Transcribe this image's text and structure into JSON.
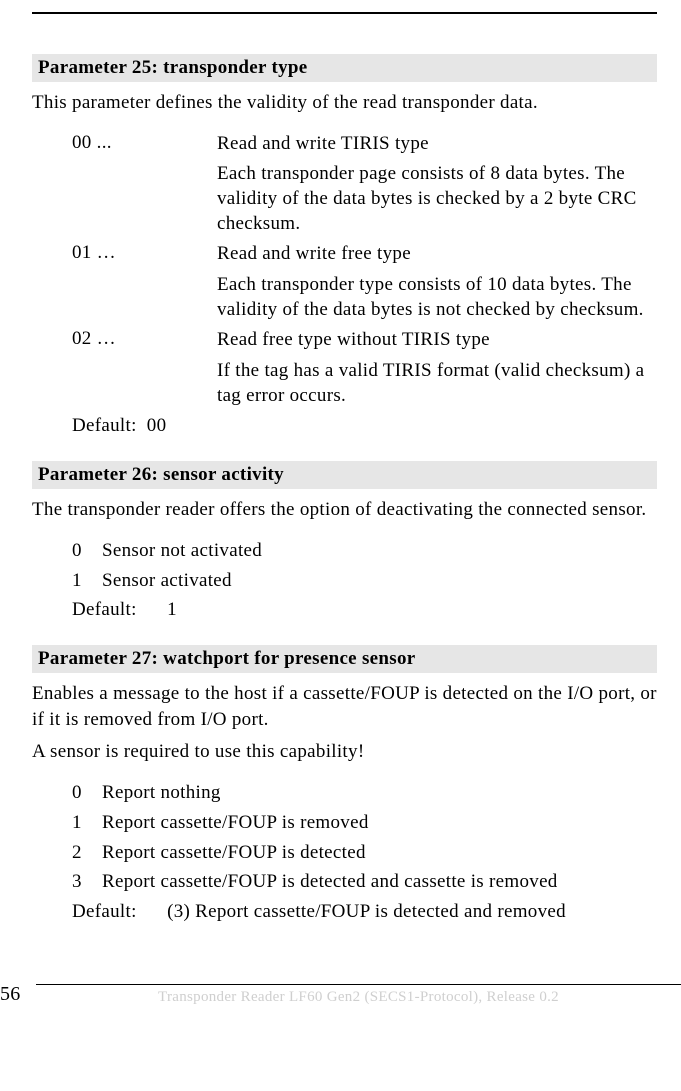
{
  "param25": {
    "header": "Parameter 25: transponder type",
    "intro": "This parameter defines the validity of the read transponder data.",
    "rows": [
      {
        "code": "00 ...",
        "desc": "Read and write TIRIS type",
        "sub": "Each transponder page consists of 8 data bytes. The validity of the data bytes is checked by a 2 byte CRC checksum."
      },
      {
        "code": "01 …",
        "desc": "Read and write free type",
        "sub": "Each transponder type consists of 10 data bytes. The validity of the data bytes is not checked by checksum."
      },
      {
        "code": "02 …",
        "desc": "Read free type without TIRIS type",
        "sub": "If the tag has a valid TIRIS format (valid checksum) a tag error occurs."
      }
    ],
    "default_label": "Default:",
    "default_value": "00"
  },
  "param26": {
    "header": "Parameter 26: sensor activity",
    "intro": "The transponder reader offers the option of deactivating the connected sensor.",
    "values": [
      {
        "code": "0",
        "label": "Sensor not activated"
      },
      {
        "code": "1",
        "label": "Sensor activated"
      }
    ],
    "default_label": "Default:",
    "default_value": "1"
  },
  "param27": {
    "header": "Parameter 27: watchport for presence sensor",
    "intro1": "Enables a message to the host if a cassette/FOUP is detected on the I/O port, or if it is removed from I/O port.",
    "intro2": "A sensor is required to use this capability!",
    "values": [
      {
        "code": "0",
        "label": "Report nothing"
      },
      {
        "code": "1",
        "label": "Report cassette/FOUP is removed"
      },
      {
        "code": "2",
        "label": "Report cassette/FOUP is detected"
      },
      {
        "code": "3",
        "label": "Report cassette/FOUP is detected and cassette is removed"
      }
    ],
    "default_label": "Default:",
    "default_value": "(3) Report cassette/FOUP is detected and removed"
  },
  "footer": {
    "page_number": "56",
    "text": "Transponder Reader LF60 Gen2 (SECS1-Protocol), Release 0.2"
  }
}
